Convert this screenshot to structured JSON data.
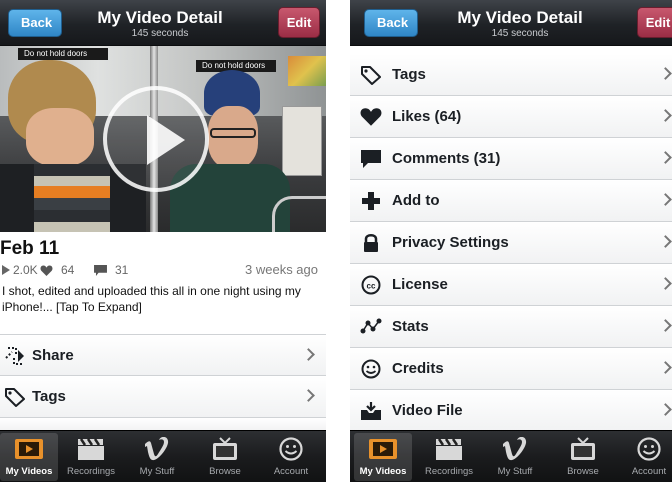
{
  "left": {
    "nav": {
      "back": "Back",
      "title": "My Video Detail",
      "subtitle": "145 seconds",
      "edit": "Edit"
    },
    "video": {
      "sign_text": "Do not hold doors"
    },
    "info": {
      "date": "Feb 11",
      "plays": "2.0K",
      "likes": "64",
      "comments": "31",
      "ago": "3 weeks ago",
      "description": "I shot, edited and uploaded this all in one night using my iPhone!... [Tap To Expand]"
    },
    "rows": [
      {
        "label": "Share",
        "icon": "share-icon"
      },
      {
        "label": "Tags",
        "icon": "tag-icon"
      }
    ]
  },
  "right": {
    "nav": {
      "back": "Back",
      "title": "My Video Detail",
      "subtitle": "145 seconds",
      "edit": "Edit"
    },
    "rows": [
      {
        "label": "Tags",
        "icon": "tag-icon"
      },
      {
        "label": "Likes (64)",
        "icon": "heart-icon"
      },
      {
        "label": "Comments (31)",
        "icon": "comment-icon"
      },
      {
        "label": "Add to",
        "icon": "plus-icon"
      },
      {
        "label": "Privacy Settings",
        "icon": "lock-icon"
      },
      {
        "label": "License",
        "icon": "cc-icon"
      },
      {
        "label": "Stats",
        "icon": "stats-icon"
      },
      {
        "label": "Credits",
        "icon": "smiley-icon"
      },
      {
        "label": "Video File",
        "icon": "inbox-icon"
      }
    ]
  },
  "tabs": [
    {
      "label": "My Videos",
      "icon": "film-icon",
      "active": true
    },
    {
      "label": "Recordings",
      "icon": "clapper-icon",
      "active": false
    },
    {
      "label": "My Stuff",
      "icon": "vimeo-icon",
      "active": false
    },
    {
      "label": "Browse",
      "icon": "tv-icon",
      "active": false
    },
    {
      "label": "Account",
      "icon": "smiley-icon",
      "active": false
    }
  ],
  "colors": {
    "accent_blue": "#2f86c6",
    "edit_red": "#9b2d45",
    "active_tab_icon": "#e8912b"
  }
}
